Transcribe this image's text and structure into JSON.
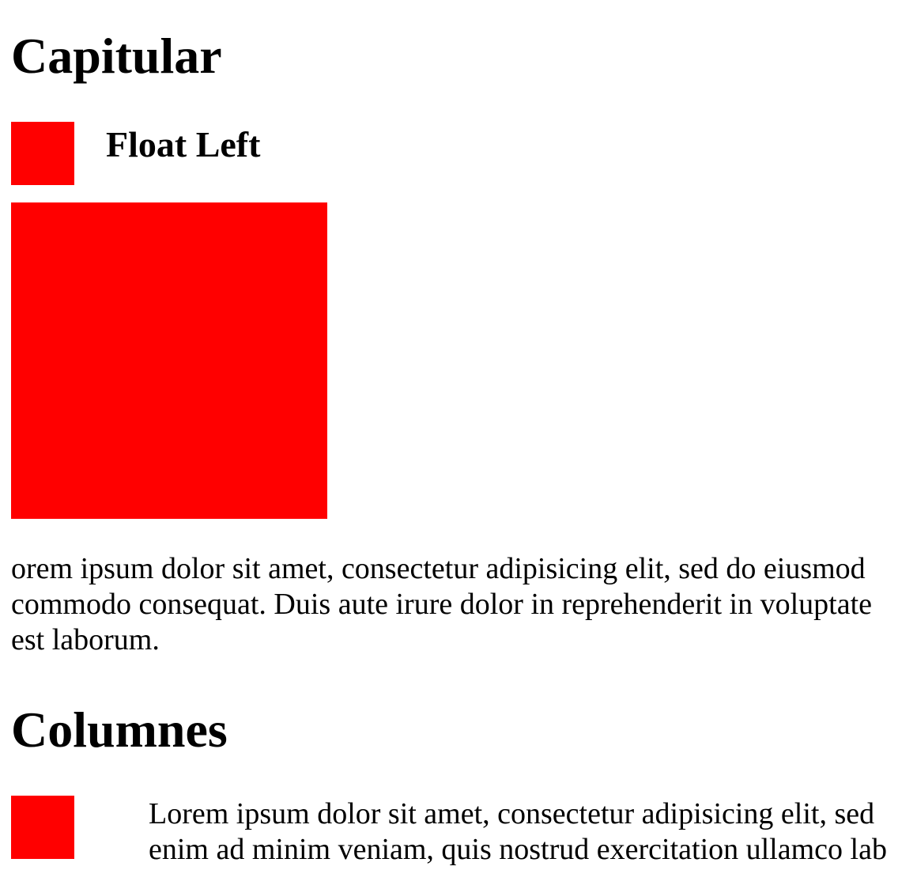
{
  "sections": {
    "capitular": {
      "title": "Capitular",
      "subtitle": "Float Left",
      "paragraph_lines": [
        "orem ipsum dolor sit amet, consectetur adipisicing elit, sed do eiusmod",
        "commodo consequat. Duis aute irure dolor in reprehenderit in voluptate",
        "est laborum."
      ]
    },
    "columnes": {
      "title": "Columnes",
      "paragraph_lines": [
        "Lorem ipsum dolor sit amet, consectetur adipisicing elit, sed",
        "enim ad minim veniam, quis nostrud exercitation ullamco lab"
      ]
    }
  },
  "colors": {
    "box": "#ff0000",
    "text": "#000000",
    "background": "#ffffff"
  }
}
